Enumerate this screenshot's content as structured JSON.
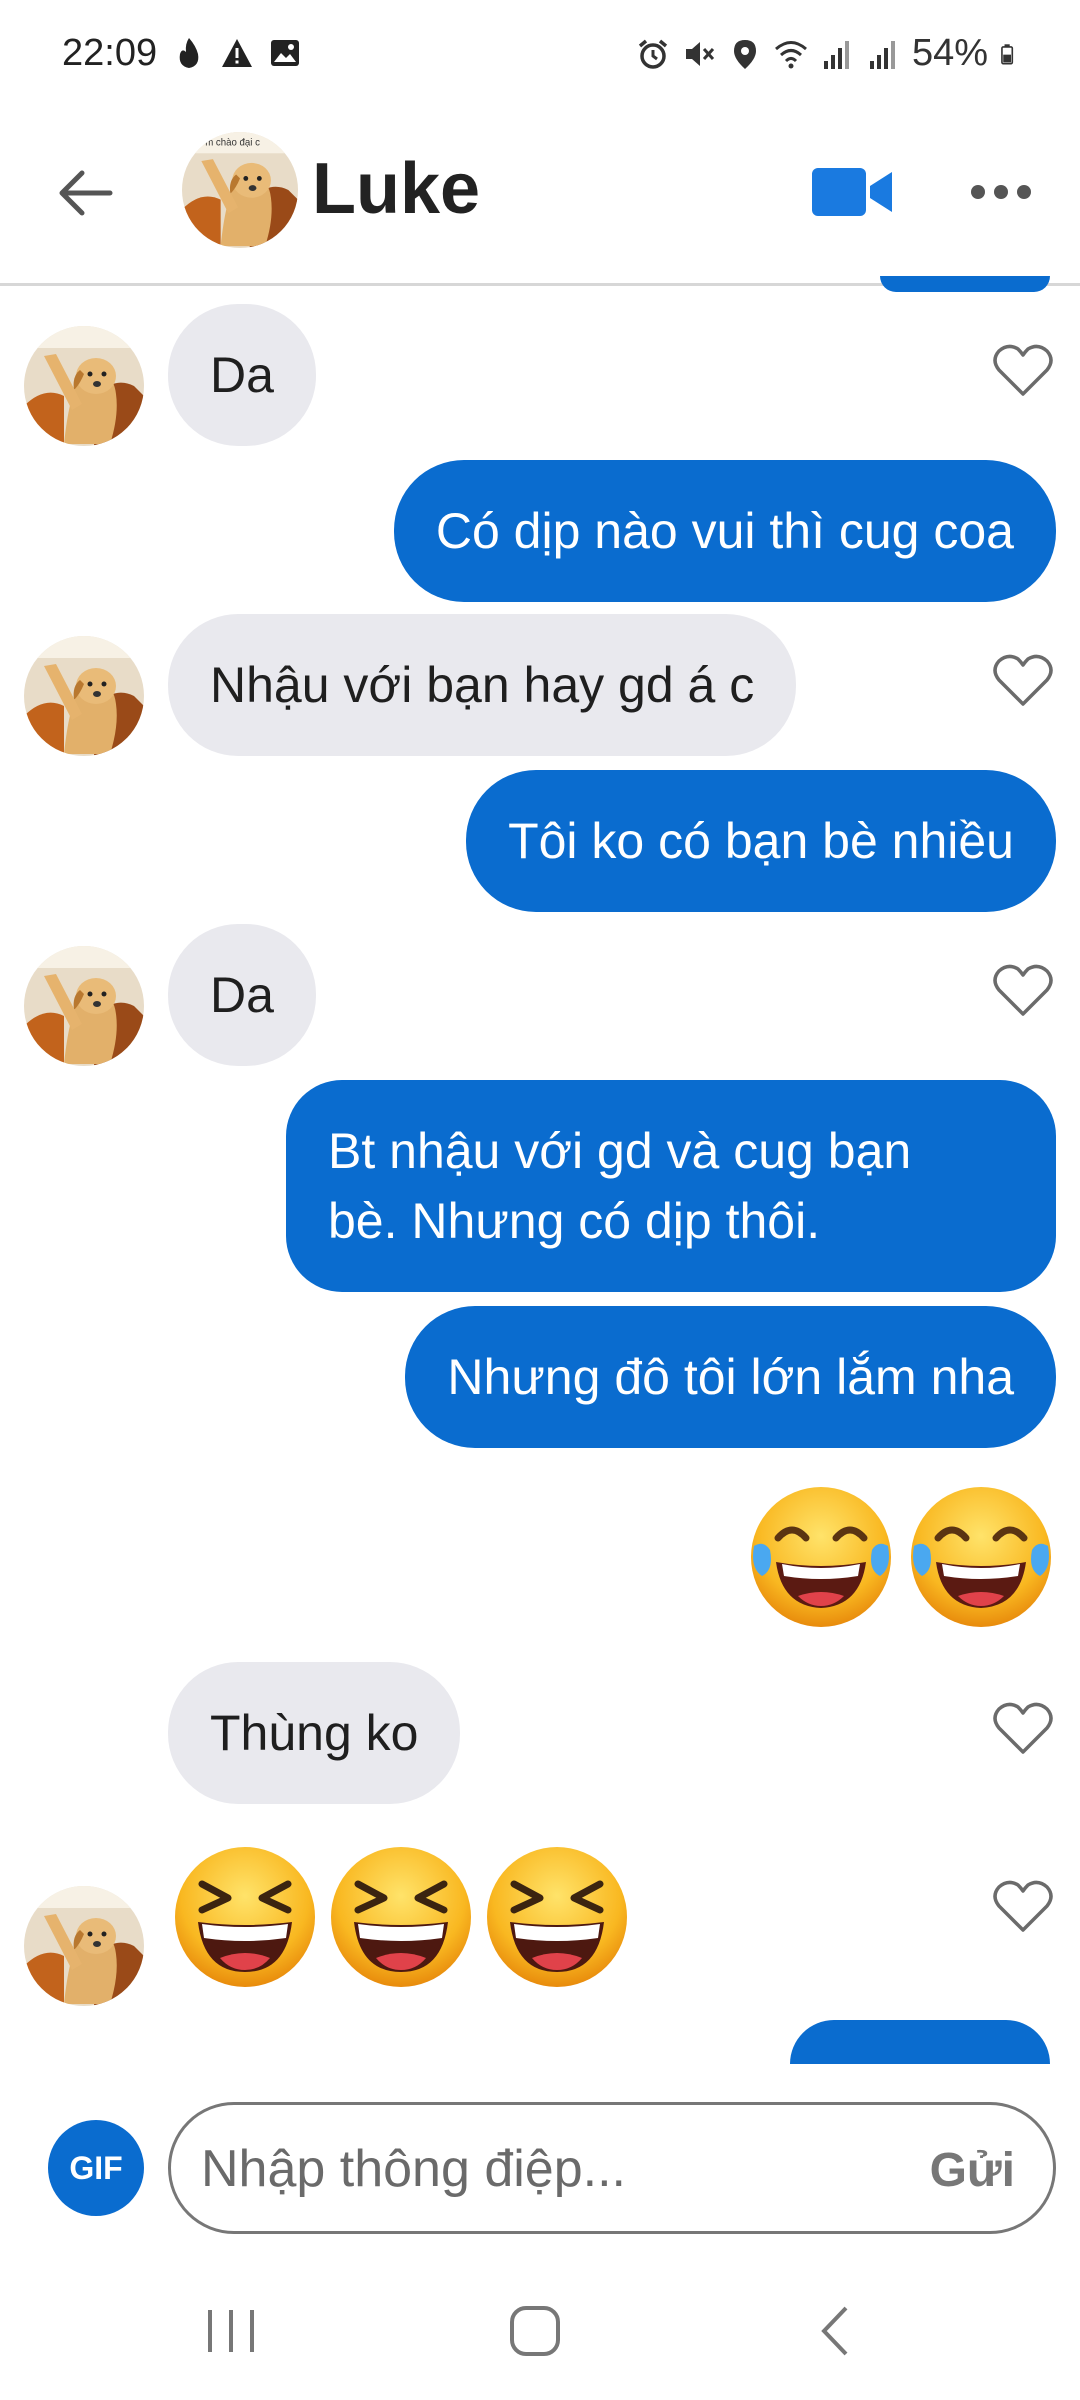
{
  "status_bar": {
    "time": "22:09",
    "battery": "54%",
    "icons": [
      "flame-icon",
      "warning-icon",
      "image-icon",
      "alarm-icon",
      "mute-icon",
      "location-icon",
      "wifi-icon",
      "signal-icon",
      "signal-icon",
      "battery-icon"
    ]
  },
  "header": {
    "contact_name": "Luke",
    "avatar_caption": "m chào đại c",
    "icons": [
      "back-arrow-icon",
      "video-camera-icon",
      "more-icon"
    ]
  },
  "messages": [
    {
      "dir": "in",
      "text": "Da"
    },
    {
      "dir": "out",
      "text": "Có dịp nào vui thì cug coa"
    },
    {
      "dir": "in",
      "text": "Nhậu với bạn hay gd á c"
    },
    {
      "dir": "out",
      "text": "Tôi ko có bạn bè nhiều"
    },
    {
      "dir": "in",
      "text": "Da"
    },
    {
      "dir": "out",
      "lines": [
        "Bt nhậu với gd và cug bạn",
        "bè. Nhưng có dịp thôi."
      ]
    },
    {
      "dir": "out",
      "text": "Nhưng đô tôi lớn lắm nha"
    },
    {
      "dir": "out",
      "emoji": "tears-of-joy",
      "count": 2
    },
    {
      "dir": "in",
      "text": "Thùng ko"
    },
    {
      "dir": "in",
      "emoji": "grinning-squinting",
      "count": 3
    }
  ],
  "composer": {
    "gif_label": "GIF",
    "placeholder": "Nhập thông điệp...",
    "send_label": "Gửi"
  },
  "colors": {
    "outgoing_bubble": "#0a6ccf",
    "incoming_bubble": "#e9e9ee",
    "accent": "#0a6ccf"
  }
}
